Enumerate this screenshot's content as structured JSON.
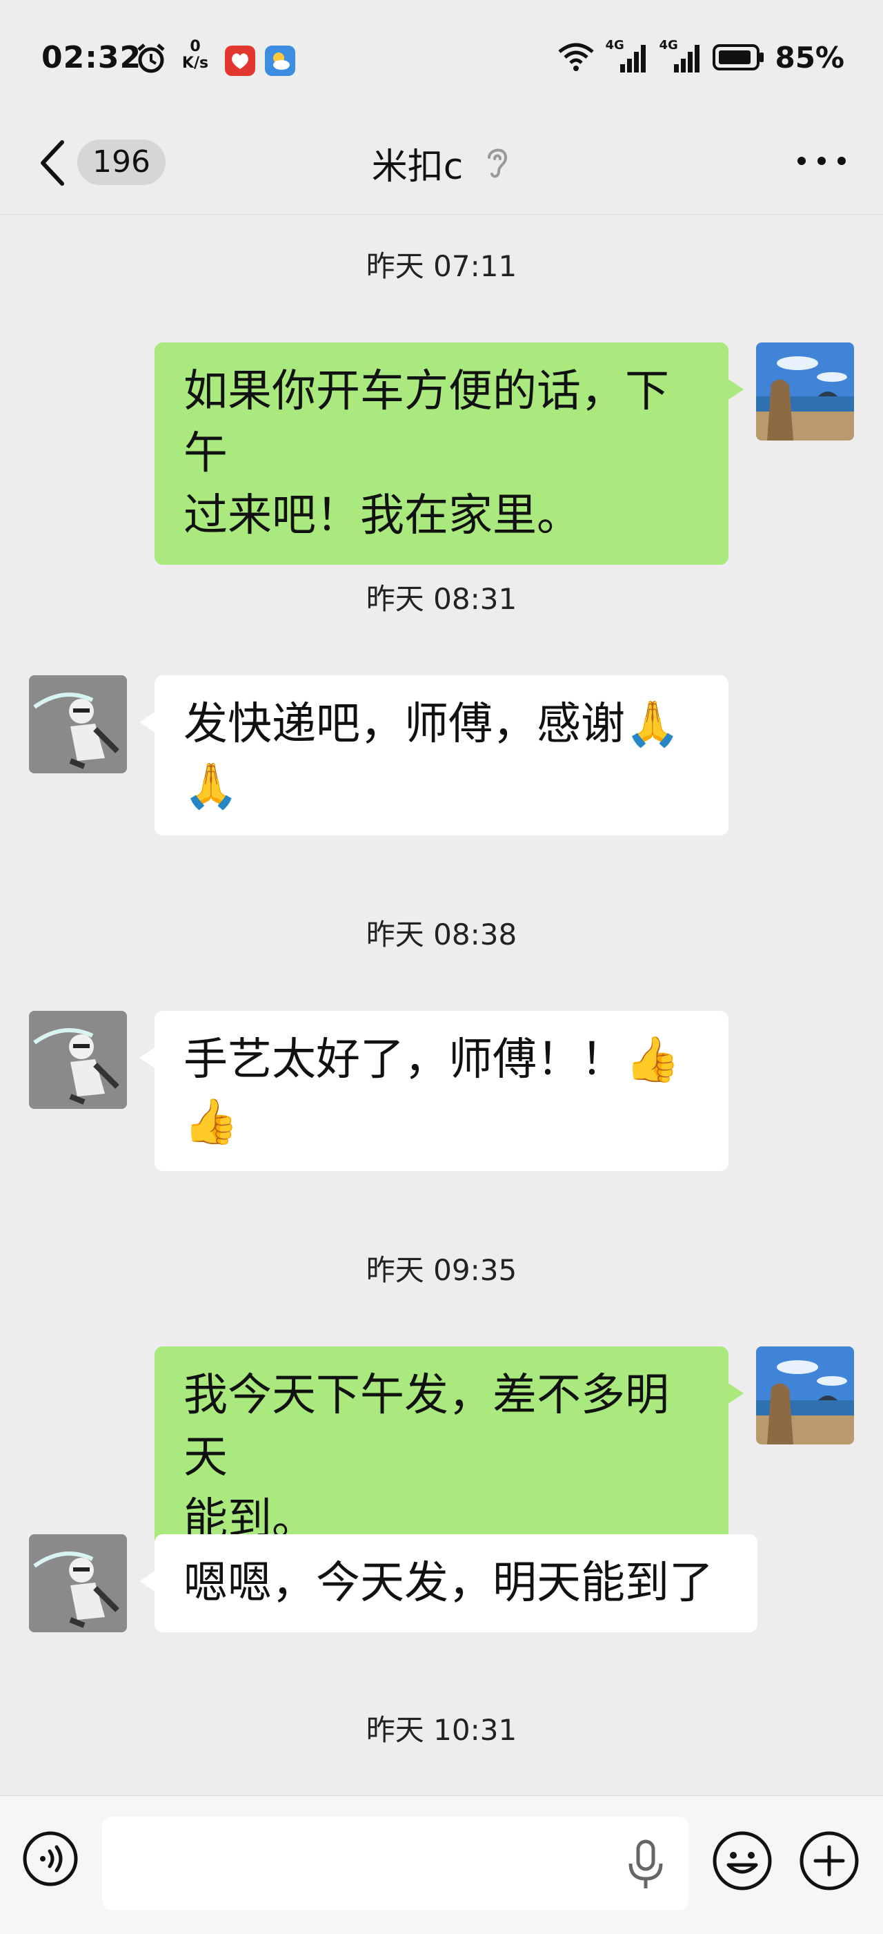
{
  "status_bar": {
    "time": "02:32",
    "net_speed_value": "0",
    "net_speed_unit": "K/s",
    "network_1": "4G",
    "network_2": "4G",
    "battery_percent": "85%"
  },
  "header": {
    "unread_count": "196",
    "title": "米扣c"
  },
  "messages": [
    {
      "type": "timestamp",
      "text": "昨天 07:11"
    },
    {
      "type": "message",
      "sender": "me",
      "line1": "如果你开车方便的话，下午",
      "line2": "过来吧！我在家里。"
    },
    {
      "type": "timestamp",
      "text": "昨天 08:31"
    },
    {
      "type": "message",
      "sender": "them",
      "line1": "发快递吧，师傅，感谢🙏",
      "line2": "🙏"
    },
    {
      "type": "timestamp",
      "text": "昨天 08:38"
    },
    {
      "type": "message",
      "sender": "them",
      "line1": "手艺太好了，师傅！！👍",
      "line2": "👍"
    },
    {
      "type": "timestamp",
      "text": "昨天 09:35"
    },
    {
      "type": "message",
      "sender": "me",
      "line1": "我今天下午发，差不多明天",
      "line2": "能到。"
    },
    {
      "type": "message",
      "sender": "them",
      "line1": "嗯嗯，今天发，明天能到了"
    },
    {
      "type": "timestamp",
      "text": "昨天 10:31"
    }
  ],
  "input_bar": {
    "value": "",
    "placeholder": ""
  },
  "icons": {
    "back": "chevron-left-icon",
    "ear": "ear-icon",
    "more": "more-icon",
    "voice": "voice-icon",
    "mic": "microphone-icon",
    "emoji": "emoji-icon",
    "plus": "plus-icon"
  },
  "colors": {
    "background": "#ededed",
    "my_bubble": "#a9e97d",
    "their_bubble": "#ffffff",
    "input_bar": "#f6f6f6"
  }
}
